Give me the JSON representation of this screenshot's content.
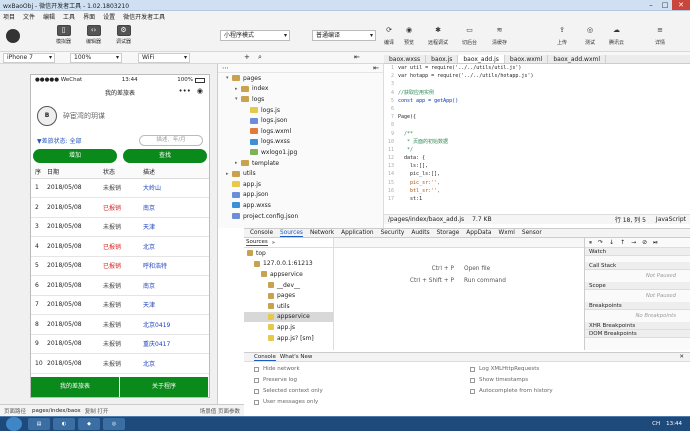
{
  "window": {
    "title": "wxBaoObj - 微信开发者工具 - 1.02.1803210"
  },
  "menu": [
    "项目",
    "文件",
    "编辑",
    "工具",
    "界面",
    "设置",
    "微信开发者工具"
  ],
  "toolbar": {
    "modes": [
      "模拟器",
      "编辑器",
      "调试器"
    ],
    "mode_select": "小程序模式",
    "compile_select": "普通编译",
    "actions": [
      "编译",
      "预览",
      "远程调试",
      "切后台",
      "清缓存"
    ],
    "right_actions": [
      "上传",
      "测试",
      "腾讯云",
      "详情"
    ]
  },
  "subbar": {
    "device": "iPhone 7",
    "zoom": "100%",
    "network": "WiFi"
  },
  "phone": {
    "status_left": "●●●●● WeChat ",
    "status_time": "13:44",
    "status_right": "100%",
    "nav_title": "我的差旅表",
    "avatar_text": "B",
    "user_name": "碎宦湾的玥谋",
    "filter_status": "▼差旅状态: 全部",
    "search_placeholder": "描述、年/月",
    "btn_add": "增加",
    "btn_search": "查找",
    "headers": [
      "序",
      "日期",
      "状态",
      "描述"
    ],
    "rows": [
      {
        "no": "1",
        "date": "2018/05/08",
        "status": "未报销",
        "status_kind": "gray",
        "desc": "大岭山"
      },
      {
        "no": "2",
        "date": "2018/05/08",
        "status": "已报销",
        "status_kind": "red",
        "desc": "南京"
      },
      {
        "no": "3",
        "date": "2018/05/08",
        "status": "未报销",
        "status_kind": "gray",
        "desc": "天津"
      },
      {
        "no": "4",
        "date": "2018/05/08",
        "status": "已报销",
        "status_kind": "red",
        "desc": "北京"
      },
      {
        "no": "5",
        "date": "2018/05/08",
        "status": "已报销",
        "status_kind": "red",
        "desc": "呼和浩特"
      },
      {
        "no": "6",
        "date": "2018/05/08",
        "status": "未报销",
        "status_kind": "gray",
        "desc": "南京"
      },
      {
        "no": "7",
        "date": "2018/05/08",
        "status": "未报销",
        "status_kind": "gray",
        "desc": "天津"
      },
      {
        "no": "8",
        "date": "2018/05/08",
        "status": "未报销",
        "status_kind": "gray",
        "desc": "北京0419"
      },
      {
        "no": "9",
        "date": "2018/05/08",
        "status": "未报销",
        "status_kind": "gray",
        "desc": "重庆0417"
      },
      {
        "no": "10",
        "date": "2018/05/08",
        "status": "未报销",
        "status_kind": "gray",
        "desc": "北京"
      }
    ],
    "bottom_left": "我的差旅表",
    "bottom_right": "关于程序"
  },
  "tree": [
    {
      "label": "pages",
      "type": "folder",
      "depth": 0,
      "open": true
    },
    {
      "label": "index",
      "type": "folder",
      "depth": 1,
      "open": false
    },
    {
      "label": "logs",
      "type": "folder",
      "depth": 1,
      "open": true
    },
    {
      "label": "logs.js",
      "type": "js",
      "depth": 2
    },
    {
      "label": "logs.json",
      "type": "json",
      "depth": 2
    },
    {
      "label": "logs.wxml",
      "type": "xml",
      "depth": 2
    },
    {
      "label": "logs.wxss",
      "type": "wxss",
      "depth": 2
    },
    {
      "label": "wxlogo1.jpg",
      "type": "img",
      "depth": 2
    },
    {
      "label": "template",
      "type": "folder",
      "depth": 1,
      "open": false
    },
    {
      "label": "utils",
      "type": "folder",
      "depth": 0,
      "open": false
    },
    {
      "label": "app.js",
      "type": "js",
      "depth": 0
    },
    {
      "label": "app.json",
      "type": "json",
      "depth": 0
    },
    {
      "label": "app.wxss",
      "type": "wxss",
      "depth": 0
    },
    {
      "label": "project.config.json",
      "type": "json",
      "depth": 0
    }
  ],
  "editor": {
    "tabs": [
      {
        "label": "baox.wxss",
        "active": false
      },
      {
        "label": "baox.js",
        "active": false
      },
      {
        "label": "baox_add.js",
        "active": true
      },
      {
        "label": "baox.wxml",
        "active": false
      },
      {
        "label": "baox_add.wxml",
        "active": false
      }
    ],
    "lines": [
      {
        "n": "1",
        "t": "var util = require('../../utils/util.js')",
        "c": ""
      },
      {
        "n": "2",
        "t": "var hotapp = require('../../utils/hotapp.js')",
        "c": ""
      },
      {
        "n": "3",
        "t": "",
        "c": ""
      },
      {
        "n": "4",
        "t": "//获取应用实例",
        "c": "cm"
      },
      {
        "n": "5",
        "t": "const app = getApp()",
        "c": "k"
      },
      {
        "n": "6",
        "t": "",
        "c": ""
      },
      {
        "n": "7",
        "t": "Page({",
        "c": ""
      },
      {
        "n": "8",
        "t": "",
        "c": ""
      },
      {
        "n": "9",
        "t": "  /**",
        "c": "cm"
      },
      {
        "n": "10",
        "t": "   * 页面的初始数据",
        "c": "cm"
      },
      {
        "n": "11",
        "t": "   */",
        "c": "cm"
      },
      {
        "n": "12",
        "t": "  data: {",
        "c": ""
      },
      {
        "n": "13",
        "t": "    ls:[],",
        "c": ""
      },
      {
        "n": "14",
        "t": "    pic_ls:[],",
        "c": ""
      },
      {
        "n": "15",
        "t": "    pic_sr:'',",
        "c": "s"
      },
      {
        "n": "16",
        "t": "    btl_sr:'',",
        "c": "s"
      },
      {
        "n": "17",
        "t": "    st:1",
        "c": ""
      }
    ],
    "status_path": "/pages/index/baox_add.js",
    "status_size": "7.7 KB",
    "status_pos": "行 18, 列 5",
    "status_lang": "JavaScript"
  },
  "devtools": {
    "tabs": [
      "Console",
      "Sources",
      "Network",
      "Application",
      "Security",
      "Audits",
      "Storage",
      "AppData",
      "Wxml",
      "Sensor"
    ],
    "active_tab": "Sources",
    "sources_label": "Sources",
    "src_tree": [
      {
        "label": "top",
        "depth": 0
      },
      {
        "label": "127.0.0.1:61213",
        "depth": 1
      },
      {
        "label": "appservice",
        "depth": 2
      },
      {
        "label": "__dev__",
        "depth": 3
      },
      {
        "label": "pages",
        "depth": 3
      },
      {
        "label": "utils",
        "depth": 3
      },
      {
        "label": "appservice",
        "depth": 3
      },
      {
        "label": "app.js",
        "depth": 3
      },
      {
        "label": "app.js? [sm]",
        "depth": 3
      }
    ],
    "shortcuts": [
      {
        "key": "Ctrl + P",
        "desc": "Open file"
      },
      {
        "key": "Ctrl + Shift + P",
        "desc": "Run command"
      }
    ],
    "sections": [
      {
        "title": "Watch",
        "body": ""
      },
      {
        "title": "Call Stack",
        "body": "Not Paused"
      },
      {
        "title": "Scope",
        "body": "Not Paused"
      },
      {
        "title": "Breakpoints",
        "body": "No Breakpoints"
      },
      {
        "title": "XHR Breakpoints",
        "body": ""
      },
      {
        "title": "DOM Breakpoints",
        "body": ""
      }
    ],
    "console_tabs": [
      "Console",
      "What's New"
    ],
    "options_left": [
      "Hide network",
      "Preserve log",
      "Selected context only",
      "User messages only"
    ],
    "options_right": [
      "Log XMLHttpRequests",
      "Show timestamps",
      "Autocomplete from history"
    ]
  },
  "pathbar": {
    "label": "页面路径",
    "path": "pages/index/baox",
    "links": "复制  打开",
    "right": "场景值   页面参数"
  },
  "taskbar": {
    "time": "13:44",
    "tray": "CH"
  }
}
